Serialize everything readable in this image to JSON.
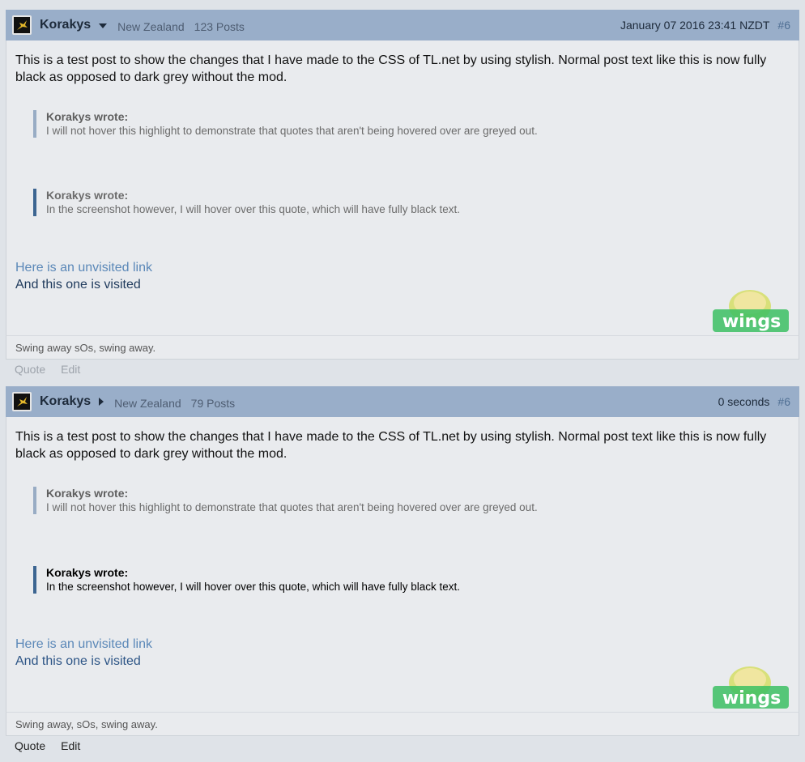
{
  "posts": [
    {
      "username": "Korakys",
      "location": "New Zealand",
      "post_count": "123 Posts",
      "date": "January 07 2016 23:41 NZDT",
      "post_number": "#6",
      "body_text": "This is a test post to show the changes that I have made to the CSS of TL.net by using stylish. Normal post text like this is now fully black as opposed to dark grey without the mod.",
      "quote1_author": "Korakys wrote:",
      "quote1_text": "I will not hover this highlight to demonstrate that quotes that aren't being hovered over are greyed out.",
      "quote2_author": "Korakys wrote:",
      "quote2_text": "In the screenshot however, I will hover over this quote, which will have fully black text.",
      "link_unvisited": "Here is an unvisited link",
      "link_visited": "And this one is visited",
      "signature": "Swing away sOs, swing away.",
      "actions": {
        "quote": "Quote",
        "edit": "Edit"
      }
    },
    {
      "username": "Korakys",
      "location": "New Zealand",
      "post_count": "79 Posts",
      "date": "0 seconds",
      "post_number": "#6",
      "body_text": "This is a test post to show the changes that I have made to the CSS of TL.net by using stylish. Normal post text like this is now fully black as opposed to dark grey without the mod.",
      "quote1_author": "Korakys wrote:",
      "quote1_text": "I will not hover this highlight to demonstrate that quotes that aren't being hovered over are greyed out.",
      "quote2_author": "Korakys wrote:",
      "quote2_text": "In the screenshot however, I will hover over this quote, which will have fully black text.",
      "link_unvisited": "Here is an unvisited link",
      "link_visited": "And this one is visited",
      "signature": "Swing away, sOs, swing away.",
      "actions": {
        "quote": "Quote",
        "edit": "Edit"
      }
    }
  ],
  "logo_text": "wings",
  "colors": {
    "header_bg": "#99aec9",
    "body_bg": "#e9ebee",
    "page_bg": "#dfe3e8",
    "quote_bar_grey": "#98acc4",
    "quote_bar_active": "#3c6591",
    "link_unvisited": "#5b88b8",
    "link_visited": "#1f3a5c",
    "logo_green": "#3cbf63"
  }
}
